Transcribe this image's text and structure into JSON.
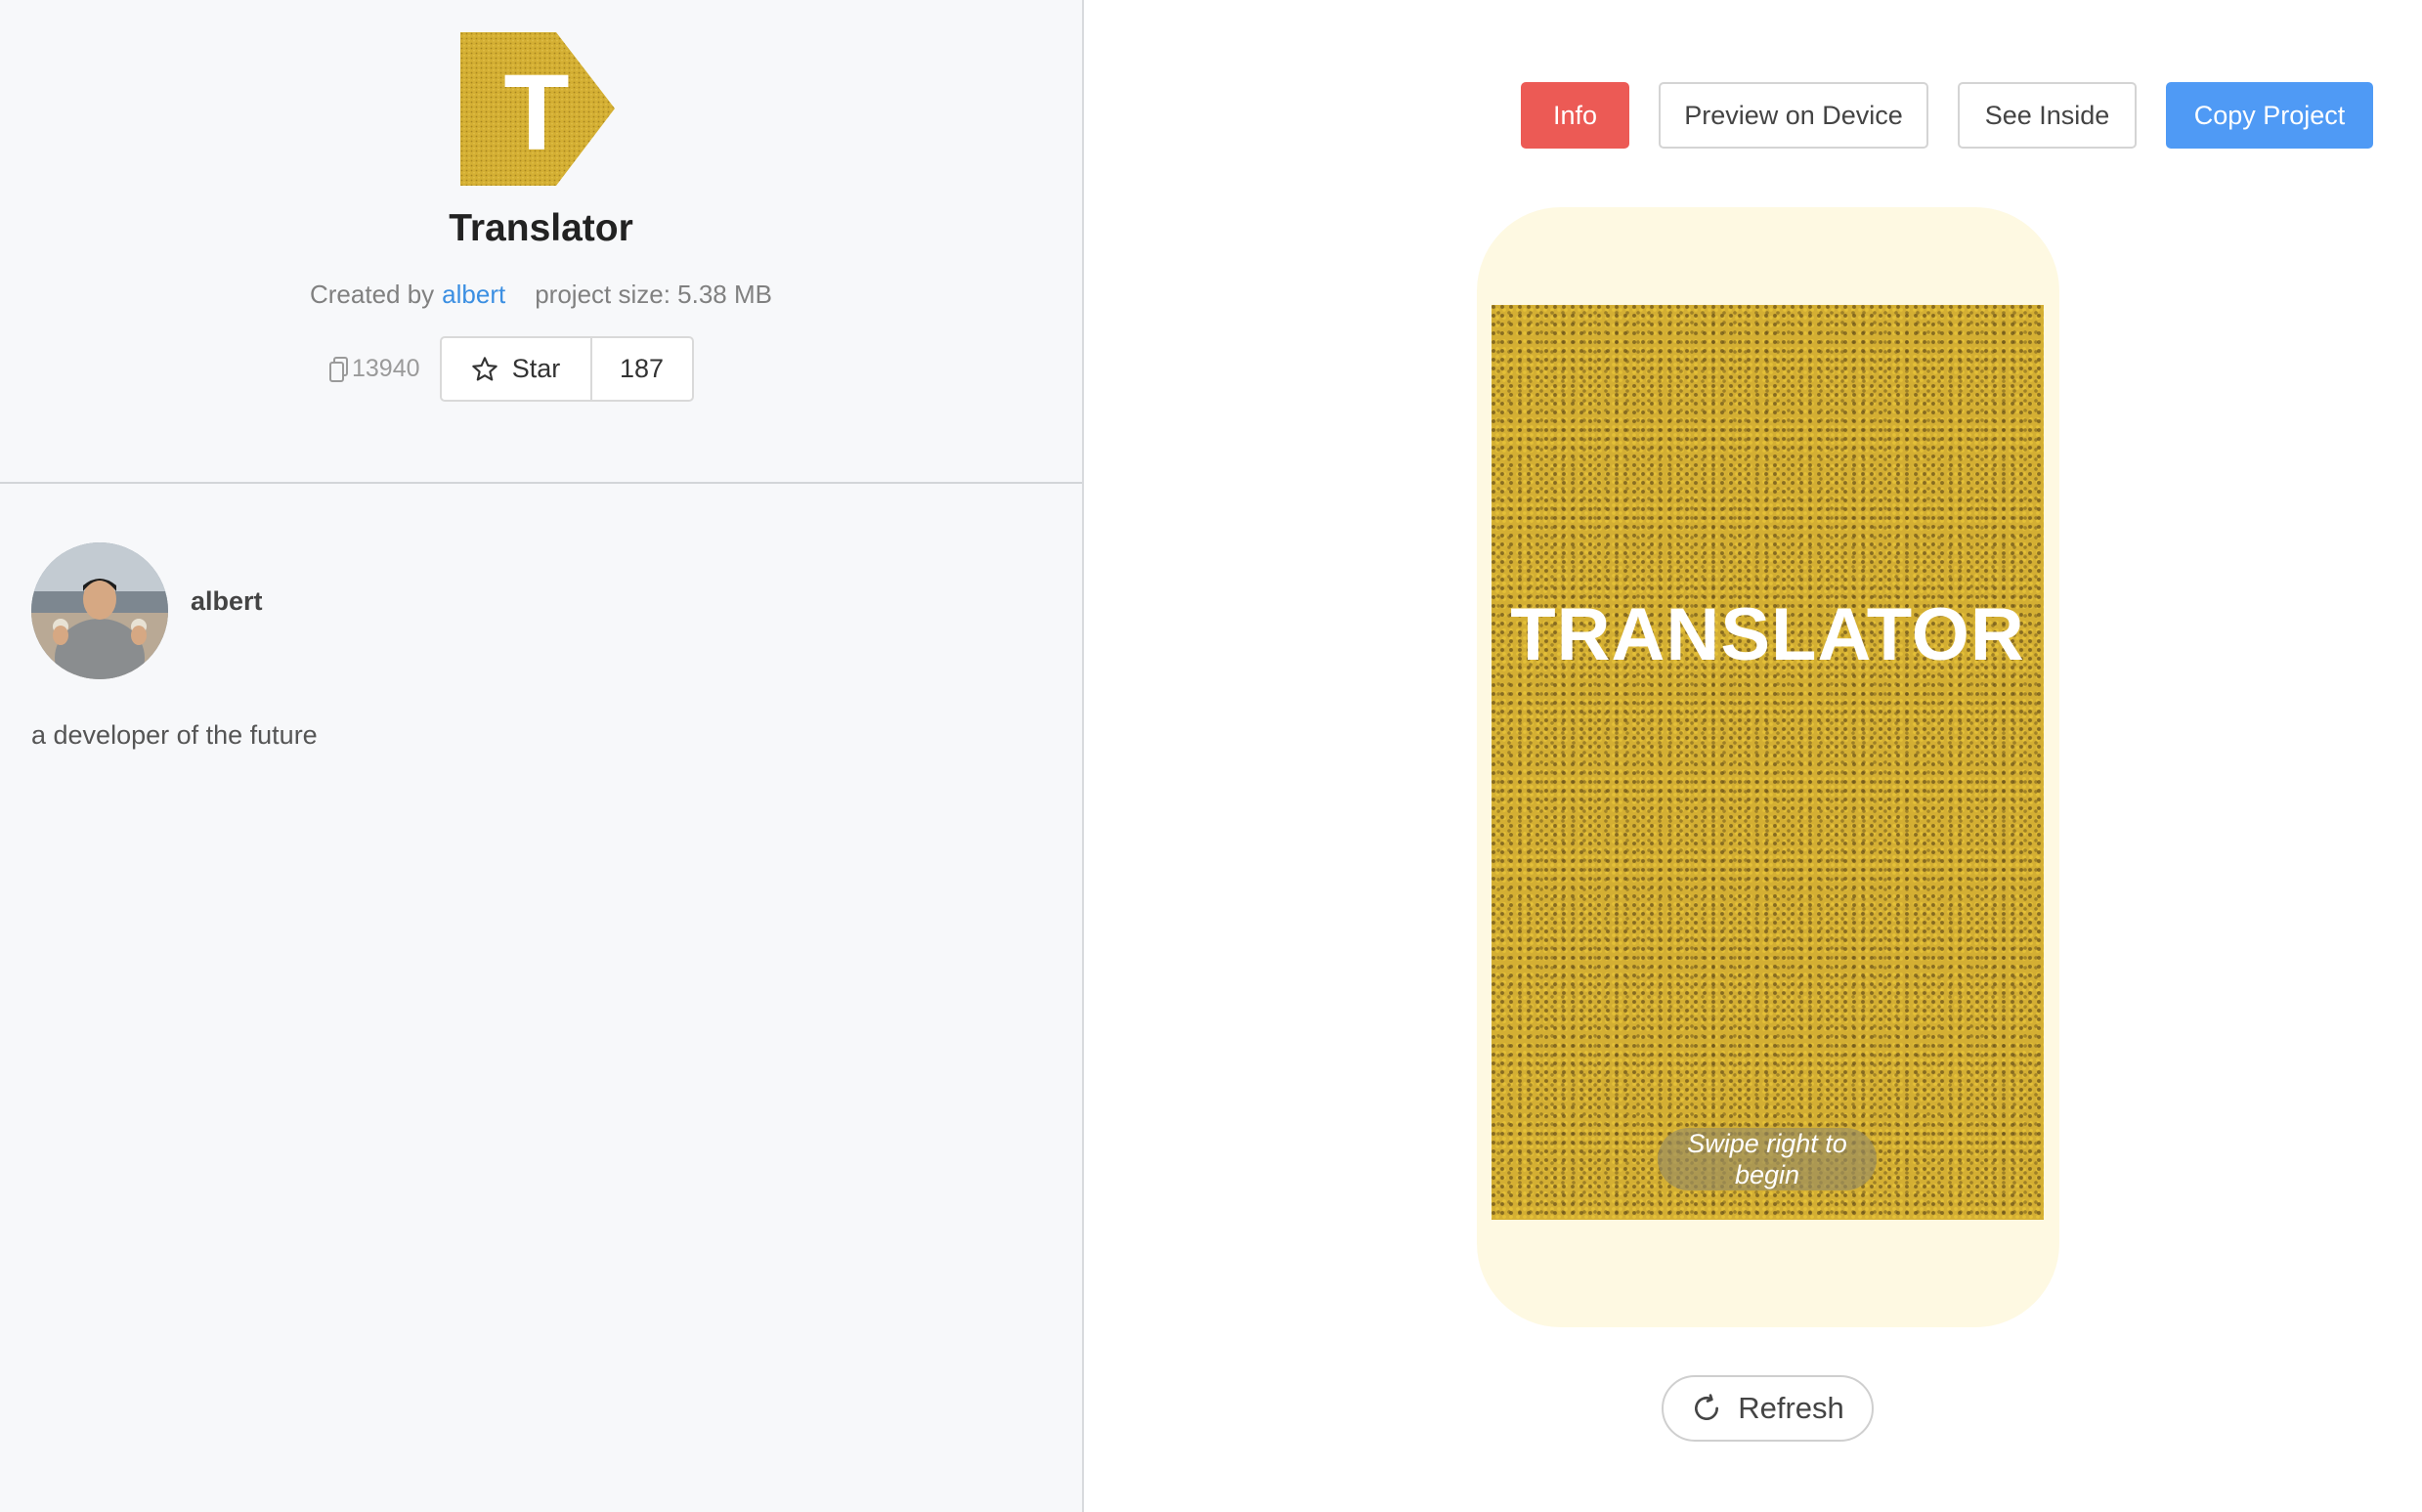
{
  "project": {
    "title": "Translator",
    "created_by_label": "Created by",
    "author": "albert",
    "size_label": "project size: 5.38 MB",
    "remix_count": "13940",
    "star_label": "Star",
    "star_count": "187",
    "logo_letter": "T"
  },
  "profile": {
    "username": "albert",
    "bio": "a developer of the future"
  },
  "toolbar": {
    "info_label": "Info",
    "preview_label": "Preview on Device",
    "see_inside_label": "See Inside",
    "copy_label": "Copy Project"
  },
  "preview": {
    "app_title": "TRANSLATOR",
    "swipe_hint": "Swipe right to begin",
    "refresh_label": "Refresh"
  },
  "colors": {
    "info": "#ec5a55",
    "copy": "#4f9af5",
    "link": "#3b8fe2",
    "logo_gold": "#d4af33",
    "device_bezel": "#fef9e2"
  },
  "icons": [
    "remix-icon",
    "star-icon",
    "refresh-icon",
    "translator-logo"
  ]
}
